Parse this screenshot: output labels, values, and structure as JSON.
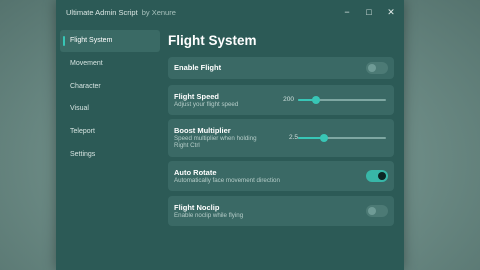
{
  "window": {
    "title": "Ultimate Admin Script",
    "subtitle": "by Xenure",
    "controls": {
      "minimize": "−",
      "maximize": "□",
      "close": "✕"
    }
  },
  "sidebar": {
    "items": [
      {
        "label": "Flight System",
        "active": true
      },
      {
        "label": "Movement"
      },
      {
        "label": "Character"
      },
      {
        "label": "Visual"
      },
      {
        "label": "Teleport"
      },
      {
        "label": "Settings"
      }
    ]
  },
  "page": {
    "title": "Flight System",
    "settings": {
      "enable_flight": {
        "label": "Enable Flight",
        "enabled": false
      },
      "flight_speed": {
        "label": "Flight Speed",
        "desc": "Adjust your flight speed",
        "value": "200",
        "fraction": 0.2
      },
      "boost_multiplier": {
        "label": "Boost Multiplier",
        "desc1": "Speed multiplier when holding",
        "desc2": "Right Ctrl",
        "value": "2.5",
        "fraction": 0.3
      },
      "auto_rotate": {
        "label": "Auto Rotate",
        "desc": "Automatically face movement direction",
        "enabled": true
      },
      "flight_noclip": {
        "label": "Flight Noclip",
        "desc": "Enable noclip while flying",
        "enabled": false
      }
    }
  },
  "colors": {
    "accent": "#38c6b6",
    "window": "#2c5a56",
    "card": "#3a6965"
  }
}
